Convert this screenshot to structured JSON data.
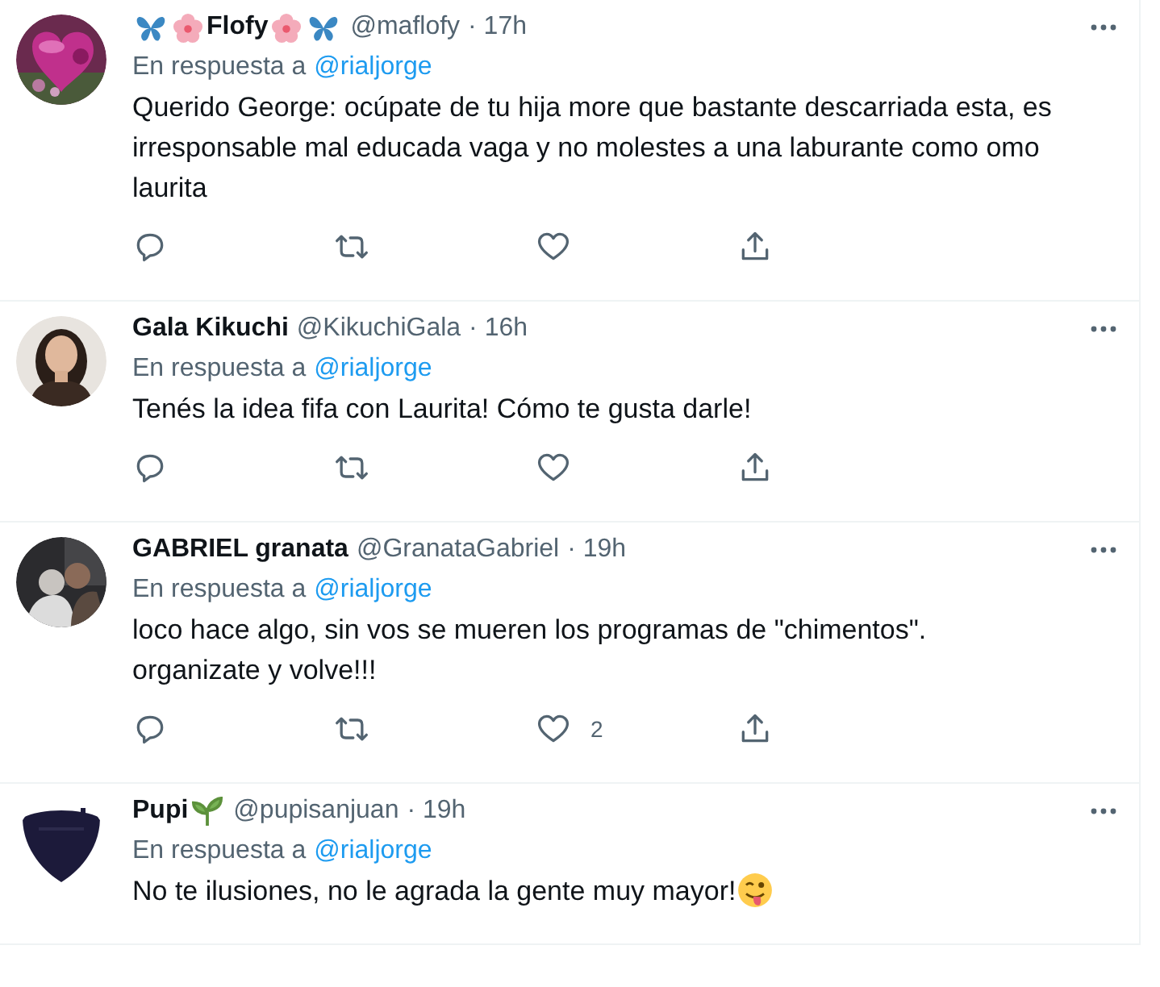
{
  "tweets": [
    {
      "avatar": {
        "kind": "picture"
      },
      "name": "Flofy",
      "icons_before": [
        {
          "kind": "butterfly"
        },
        {
          "kind": "flower"
        }
      ],
      "icons_after": [
        {
          "kind": "flower"
        },
        {
          "kind": "butterfly"
        }
      ],
      "handle": "@maflofy",
      "time": "· 17h",
      "reply_label": "En respuesta a",
      "reply_to": "@rialjorge",
      "text": "Querido George: ocúpate de tu hija more que bastante descarriada esta, es irresponsable mal educada vaga  y no molestes a una laburante como omo laurita",
      "actions": [
        {
          "kind": "reply"
        },
        {
          "kind": "retweet"
        },
        {
          "kind": "like"
        },
        {
          "kind": "share"
        }
      ]
    },
    {
      "avatar": {
        "kind": "picture"
      },
      "name": "Gala Kikuchi",
      "handle": "@KikuchiGala",
      "time": "· 16h",
      "reply_label": "En respuesta a",
      "reply_to": "@rialjorge",
      "text": "Tenés la idea fifa con Laurita! Cómo te gusta darle!",
      "actions": [
        {
          "kind": "reply"
        },
        {
          "kind": "retweet"
        },
        {
          "kind": "like"
        },
        {
          "kind": "share"
        }
      ]
    },
    {
      "avatar": {
        "kind": "picture"
      },
      "name": "GABRIEL granata",
      "handle": "@GranataGabriel",
      "time": "· 19h",
      "reply_label": "En respuesta a",
      "reply_to": "@rialjorge",
      "text": "loco hace algo, sin vos se mueren los programas de \"chimentos\". organizate y volve!!!",
      "actions": [
        {
          "kind": "reply"
        },
        {
          "kind": "retweet"
        },
        {
          "kind": "like",
          "count": "2"
        },
        {
          "kind": "share"
        }
      ]
    },
    {
      "avatar": {
        "kind": "picture"
      },
      "name": "Pupi",
      "icons_after": [
        {
          "kind": "sprout"
        }
      ],
      "handle": "@pupisanjuan",
      "time": "· 19h",
      "reply_label": "En respuesta a",
      "reply_to": "@rialjorge",
      "text": "No te ilusiones, no le agrada la gente muy mayor!",
      "text_icons": [
        {
          "kind": "winking-face"
        }
      ]
    }
  ]
}
